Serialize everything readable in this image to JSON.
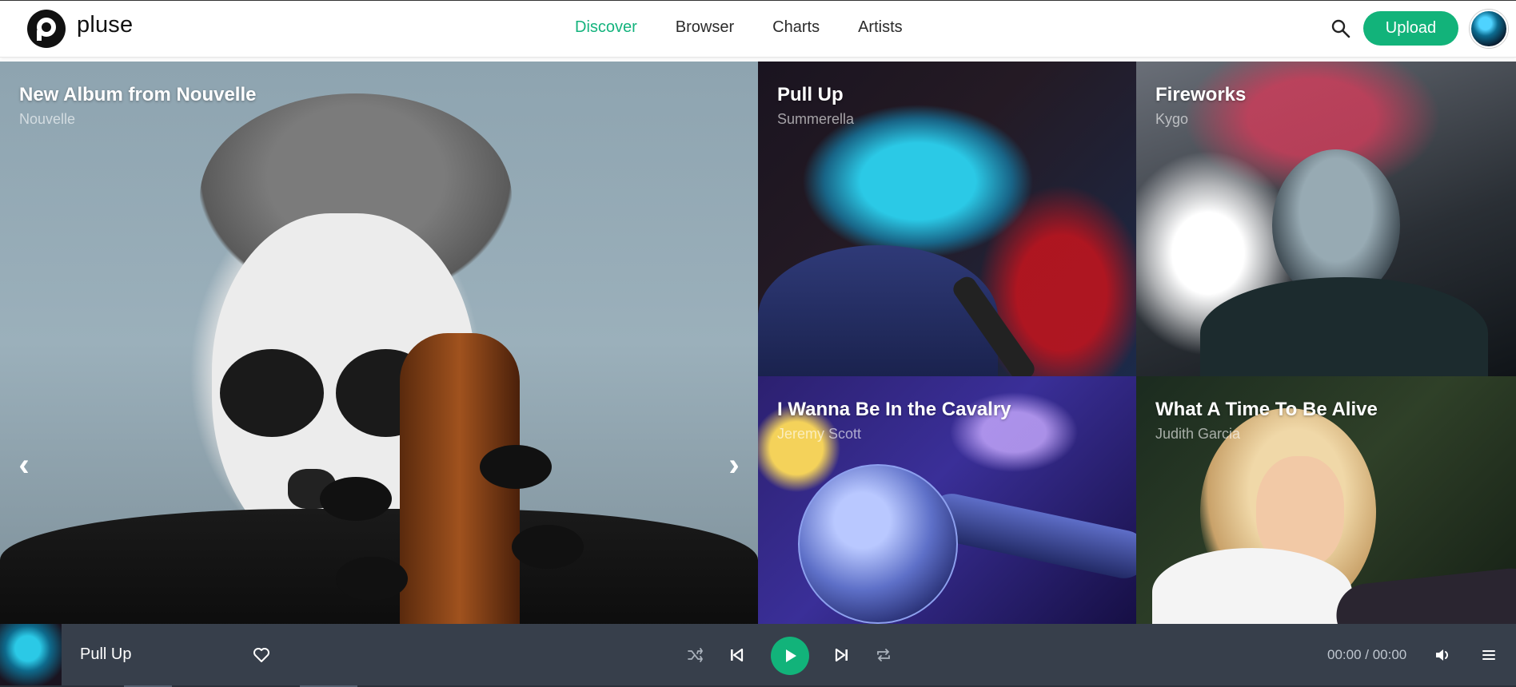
{
  "app": {
    "brand": "pluse"
  },
  "nav": {
    "items": [
      {
        "label": "Discover",
        "active": true
      },
      {
        "label": "Browser",
        "active": false
      },
      {
        "label": "Charts",
        "active": false
      },
      {
        "label": "Artists",
        "active": false
      }
    ]
  },
  "header": {
    "upload_label": "Upload",
    "search_icon": "search-icon",
    "accent": "#12b37a"
  },
  "hero": {
    "main": {
      "title": "New Album from Nouvelle",
      "artist": "Nouvelle"
    },
    "tiles": [
      {
        "title": "Pull Up",
        "artist": "Summerella"
      },
      {
        "title": "Fireworks",
        "artist": "Kygo"
      },
      {
        "title": "I Wanna Be In the Cavalry",
        "artist": "Jeremy Scott"
      },
      {
        "title": "What A Time To Be Alive",
        "artist": "Judith Garcia"
      }
    ]
  },
  "player": {
    "track": "Pull Up",
    "time": "00:00 / 00:00",
    "icons": [
      "heart-icon",
      "shuffle-icon",
      "previous-icon",
      "play-icon",
      "next-icon",
      "repeat-icon",
      "volume-icon",
      "playlist-icon"
    ],
    "bar_color": "#373f4b"
  }
}
